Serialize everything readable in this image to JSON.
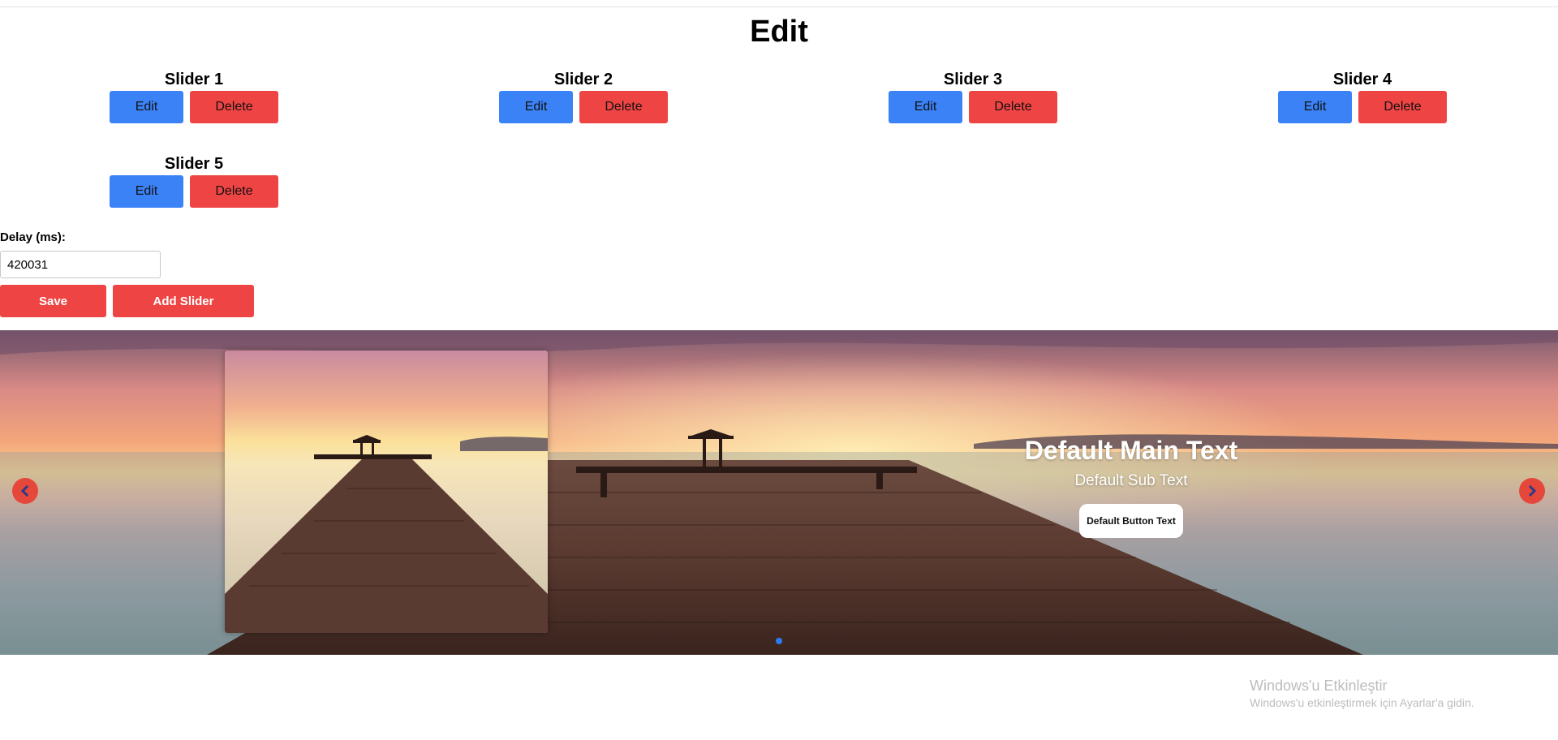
{
  "page": {
    "title": "Edit"
  },
  "sliders": [
    {
      "name": "Slider 1",
      "edit_label": "Edit",
      "delete_label": "Delete"
    },
    {
      "name": "Slider 2",
      "edit_label": "Edit",
      "delete_label": "Delete"
    },
    {
      "name": "Slider 3",
      "edit_label": "Edit",
      "delete_label": "Delete"
    },
    {
      "name": "Slider 4",
      "edit_label": "Edit",
      "delete_label": "Delete"
    },
    {
      "name": "Slider 5",
      "edit_label": "Edit",
      "delete_label": "Delete"
    }
  ],
  "settings": {
    "delay_label": "Delay (ms):",
    "delay_value": "420031",
    "save_label": "Save",
    "add_slider_label": "Add Slider"
  },
  "preview": {
    "main_text": "Default Main Text",
    "sub_text": "Default Sub Text",
    "button_text": "Default Button Text",
    "prev_icon": "chevron-left-icon",
    "next_icon": "chevron-right-icon",
    "dot_count": 1,
    "active_dot": 0
  },
  "watermark": {
    "title": "Windows'u Etkinleştir",
    "subtitle": "Windows'u etkinleştirmek için Ayarlar'a gidin."
  },
  "colors": {
    "edit_button": "#3b82f6",
    "delete_button": "#ef4444",
    "primary_red": "#ef4444",
    "carousel_arrow": "#e5483b",
    "carousel_dot": "#2b7cf0"
  }
}
